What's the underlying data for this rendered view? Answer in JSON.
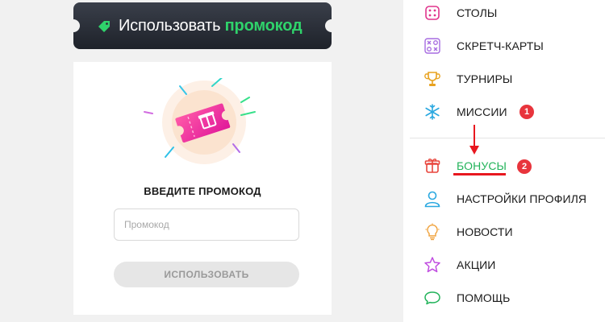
{
  "promo_banner": {
    "text_main": "Использовать",
    "text_accent": "промокод",
    "icon": "tag-icon",
    "accent_color": "#2fd36b"
  },
  "promo_card": {
    "illustration": "gift-ticket-icon",
    "title": "ВВЕДИТЕ ПРОМОКОД",
    "input": {
      "placeholder": "Промокод",
      "value": ""
    },
    "button_label": "ИСПОЛЬЗОВАТЬ"
  },
  "side_menu": {
    "items": [
      {
        "label": "СТОЛЫ",
        "icon": "dice-icon"
      },
      {
        "label": "СКРЕТЧ-КАРТЫ",
        "icon": "scratch-card-icon"
      },
      {
        "label": "ТУРНИРЫ",
        "icon": "trophy-icon"
      },
      {
        "label": "МИССИИ",
        "icon": "snowflake-icon"
      },
      {
        "label": "БОНУСЫ",
        "icon": "gift-icon",
        "active": true
      },
      {
        "label": "НАСТРОЙКИ ПРОФИЛЯ",
        "icon": "user-icon"
      },
      {
        "label": "НОВОСТИ",
        "icon": "lightbulb-icon"
      },
      {
        "label": "АКЦИИ",
        "icon": "star-icon"
      },
      {
        "label": "ПОМОЩЬ",
        "icon": "chat-bubble-icon"
      }
    ],
    "annotations": [
      {
        "badge": "1"
      },
      {
        "badge": "2"
      }
    ],
    "active_color": "#22b35a",
    "annotation_color": "#e8343c"
  }
}
